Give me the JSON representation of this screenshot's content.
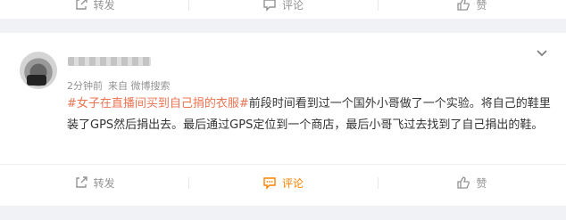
{
  "top_actions": {
    "forward": "转发",
    "comment": "评论",
    "like": "赞"
  },
  "post": {
    "meta": {
      "time": "2分钟前",
      "source": "来自 微博搜索"
    },
    "topic": "#女子在直播间买到自己捐的衣服#",
    "body": "前段时间看到过一个国外小哥做了一个实验。将自己的鞋里装了GPS然后捐出去。最后通过GPS定位到一个商店，最后小哥飞过去找到了自己捐出的鞋。"
  },
  "bottom_actions": {
    "forward": "转发",
    "comment": "评论",
    "like": "赞"
  },
  "colors": {
    "accent": "#ff8200",
    "topic": "#eb7350",
    "muted": "#939393"
  },
  "icons": [
    "forward-icon",
    "comment-icon",
    "like-icon",
    "chevron-down-icon"
  ]
}
